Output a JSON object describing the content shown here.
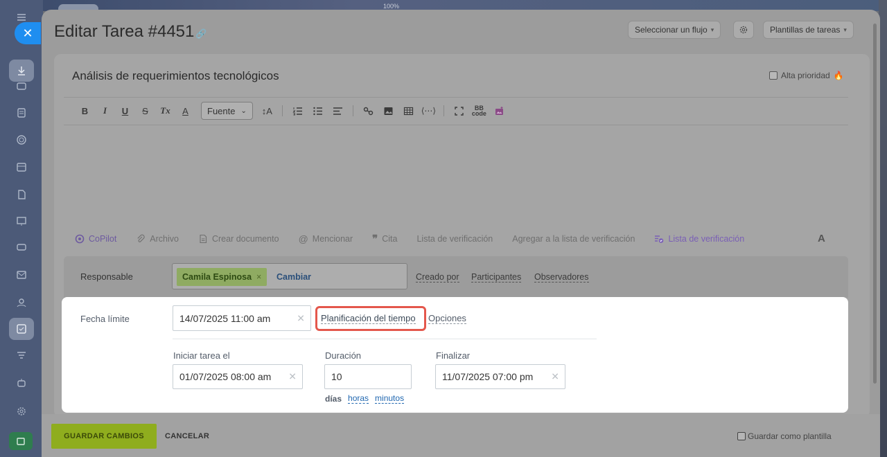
{
  "browser": {
    "zoom": "100%"
  },
  "header": {
    "title": "Editar Tarea #4451",
    "flow_select": "Seleccionar un flujo",
    "templates_button": "Plantillas de tareas"
  },
  "task": {
    "title": "Análisis de requerimientos tecnológicos",
    "high_priority_label": "Alta prioridad"
  },
  "editor_toolbar": {
    "bold": "B",
    "italic": "I",
    "underline": "U",
    "strike": "S",
    "clear_format": "Tx",
    "font_color": "A",
    "font_select": "Fuente",
    "font_size": "↕A"
  },
  "editor_footer": {
    "copilot": "CoPilot",
    "file": "Archivo",
    "create_doc": "Crear documento",
    "mention": "Mencionar",
    "quote": "Cita",
    "checklist": "Lista de verificación",
    "add_checklist": "Agregar a la lista de verificación",
    "checklist_2": "Lista de verificación",
    "format_toggle": "A"
  },
  "responsible": {
    "label": "Responsable",
    "person": "Camila Espinosa",
    "change": "Cambiar",
    "created_by": "Creado por",
    "participants": "Participantes",
    "observers": "Observadores"
  },
  "deadline": {
    "label": "Fecha límite",
    "value": "14/07/2025 11:00 am",
    "time_planning": "Planificación del tiempo",
    "options": "Opciones",
    "start_label": "Iniciar tarea el",
    "start_value": "01/07/2025 08:00 am",
    "duration_label": "Duración",
    "duration_value": "10",
    "finish_label": "Finalizar",
    "finish_value": "11/07/2025 07:00 pm",
    "unit_days": "días",
    "unit_hours": "horas",
    "unit_minutes": "minutos"
  },
  "footer": {
    "save": "GUARDAR CAMBIOS",
    "cancel": "CANCELAR",
    "save_template": "Guardar como plantilla"
  },
  "colors": {
    "highlight_frame": "#e4574c",
    "save_button": "#8fad1e",
    "link_blue": "#2067b0"
  }
}
